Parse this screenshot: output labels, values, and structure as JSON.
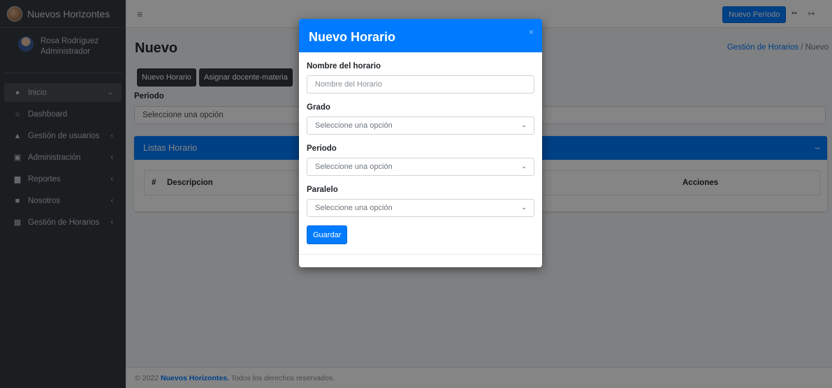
{
  "brand": {
    "name": "Nuevos Horizontes"
  },
  "user": {
    "name": "Rosa Rodríguez",
    "role": "Administrador"
  },
  "sidebar": {
    "items": [
      {
        "label": "Inicio",
        "icon": "tachometer-icon"
      },
      {
        "label": "Dashboard",
        "icon": "circle-icon"
      },
      {
        "label": "Gestión de usuarios",
        "icon": "user-icon"
      },
      {
        "label": "Administración",
        "icon": "building-icon"
      },
      {
        "label": "Reportes",
        "icon": "chart-icon"
      },
      {
        "label": "Nosotros",
        "icon": "id-card-icon"
      },
      {
        "label": "Gestión de Horarios",
        "icon": "calendar-icon"
      }
    ]
  },
  "topbar": {
    "new_period_label": "Nuevo Período"
  },
  "page": {
    "title": "Nuevo",
    "breadcrumb": {
      "parent": "Gestión de Horarios",
      "separator": "/",
      "current": "Nuevo"
    },
    "buttons": {
      "new_schedule": "Nuevo Horario",
      "assign_teacher": "Asignar docente-materia"
    },
    "periodo_label": "Periodo",
    "periodo_select": "Seleccione una opción"
  },
  "card": {
    "title": "Listas Horario",
    "collapse": "−",
    "columns": [
      "#",
      "Descripcion",
      "Acciones"
    ]
  },
  "footer": {
    "prefix": "© 2022",
    "brand": "Nuevos Horizontes.",
    "suffix": "Todos los derechos reservados."
  },
  "modal": {
    "title": "Nuevo Horario",
    "close": "×",
    "fields": {
      "name_label": "Nombre del horario",
      "name_placeholder": "Nombre del Horario",
      "grado_label": "Grado",
      "grado_value": "Seleccione una opción",
      "periodo_label": "Periodo",
      "periodo_value": "Seleccione una opción",
      "paralelo_label": "Paralelo",
      "paralelo_value": "Seleccione una opción"
    },
    "save_label": "Guardar"
  },
  "colors": {
    "primary": "#007bff",
    "sidebar": "#343a40",
    "dark_button": "#343a40"
  }
}
